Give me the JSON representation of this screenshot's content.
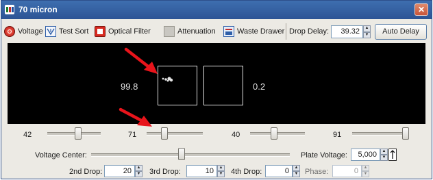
{
  "window": {
    "title": "70 micron"
  },
  "toolbar": {
    "voltage": "Voltage",
    "test_sort": "Test Sort",
    "optical_filter": "Optical Filter",
    "attenuation": "Attenuation",
    "waste_drawer": "Waste Drawer",
    "drop_delay_label": "Drop Delay:",
    "drop_delay_value": "39.32",
    "auto_delay": "Auto Delay"
  },
  "plot": {
    "left_gate_percent": "99.8",
    "right_gate_percent": "0.2"
  },
  "sliders": [
    {
      "label": "42",
      "level": 0.55
    },
    {
      "label": "71",
      "level": 0.28
    },
    {
      "label": "40",
      "level": 0.42
    },
    {
      "label": "91",
      "level": 0.97
    }
  ],
  "voltage_center": {
    "label": "Voltage Center:",
    "level": 0.44
  },
  "plate_voltage": {
    "label": "Plate Voltage:",
    "value": "5,000"
  },
  "drops": {
    "second_label": "2nd Drop:",
    "second_value": "20",
    "third_label": "3rd Drop:",
    "third_value": "10",
    "fourth_label": "4th Drop:",
    "fourth_value": "0",
    "phase_label": "Phase:",
    "phase_value": "0"
  },
  "colors": {
    "title_bar": "#2c5495",
    "annotation_arrow": "#e8141b",
    "plot_background": "#000000"
  }
}
